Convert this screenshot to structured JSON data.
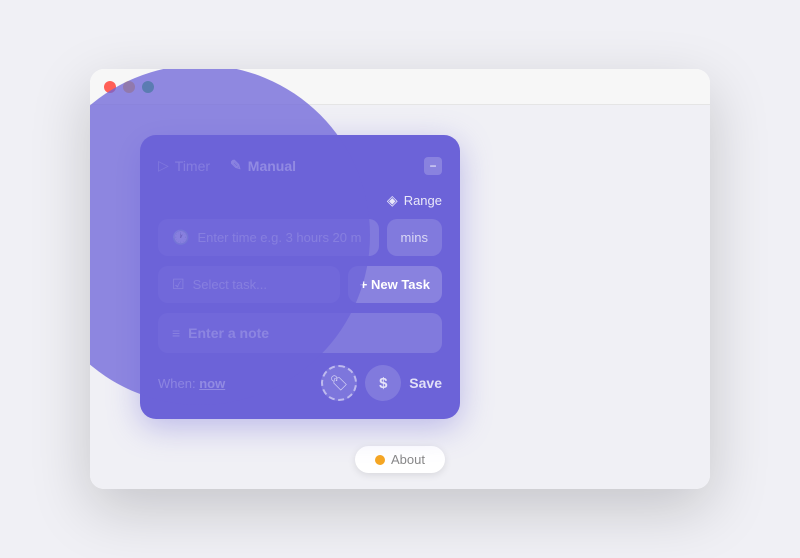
{
  "browser": {
    "dot_colors": [
      "#ff5f57",
      "#febc2e",
      "#28c840"
    ]
  },
  "tabs": {
    "timer_label": "Timer",
    "manual_label": "Manual",
    "timer_icon": "▷",
    "manual_icon": "✎"
  },
  "panel": {
    "minimize_icon": "−",
    "range_label": "Range",
    "range_icon": "◈",
    "time_placeholder": "Enter time e.g. 3 hours 20 m",
    "mins_label": "mins",
    "task_placeholder": "Select task...",
    "new_task_label": "+ New Task",
    "note_placeholder": "Enter a note",
    "note_icon": "≡",
    "when_label": "When:",
    "when_value": "now",
    "tag_icon": "🏷",
    "dollar_icon": "$",
    "save_label": "Save"
  },
  "about": {
    "label": "About"
  }
}
